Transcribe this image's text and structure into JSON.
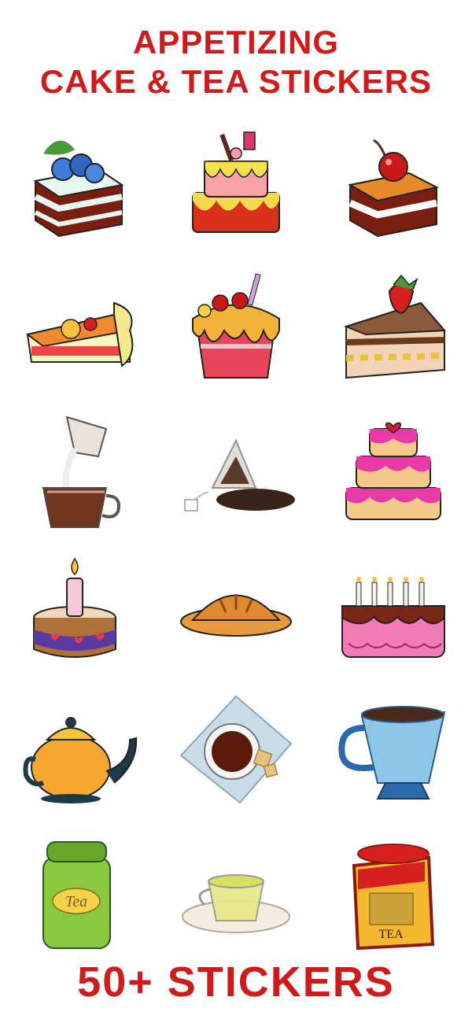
{
  "header": {
    "line1": "APPETIZING",
    "line2": "CAKE & TEA STICKERS"
  },
  "footer": {
    "text": "50+ STICKERS"
  },
  "colors": {
    "title": "#d11a1a",
    "background": "#ffffff"
  },
  "stickers": [
    {
      "icon": "blueberry-cake-slice-icon"
    },
    {
      "icon": "pink-candle-cake-icon"
    },
    {
      "icon": "cherry-cake-slice-icon"
    },
    {
      "icon": "citrus-pie-slice-icon"
    },
    {
      "icon": "cherry-cupcake-icon"
    },
    {
      "icon": "strawberry-layer-cake-slice-icon"
    },
    {
      "icon": "pouring-tea-cup-icon"
    },
    {
      "icon": "tea-bag-with-leaves-icon"
    },
    {
      "icon": "three-tier-pink-cake-icon"
    },
    {
      "icon": "single-candle-cake-icon"
    },
    {
      "icon": "baked-pie-icon"
    },
    {
      "icon": "birthday-cake-with-candles-icon"
    },
    {
      "icon": "orange-teapot-icon"
    },
    {
      "icon": "tea-cup-on-plate-icon"
    },
    {
      "icon": "blue-tea-mug-icon"
    },
    {
      "icon": "green-tea-tin-icon"
    },
    {
      "icon": "glass-tea-cup-saucer-icon"
    },
    {
      "icon": "red-tea-box-icon"
    }
  ],
  "labels": {
    "tin_text": "Tea",
    "box_text": "TEA"
  }
}
